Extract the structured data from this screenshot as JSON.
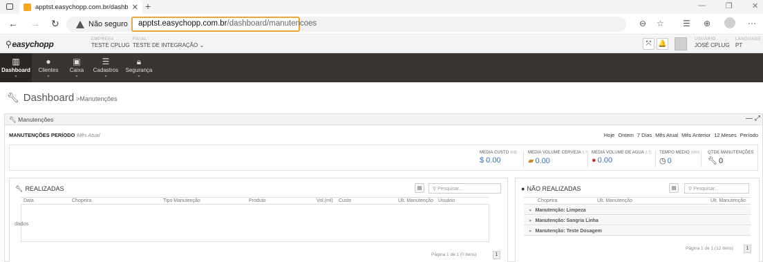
{
  "browser": {
    "tab_title": "apptst.easychopp.com.br/dashb",
    "not_secure_label": "Não seguro",
    "url_host": "apptst.easychopp.com.br",
    "url_path": "/dashboard/manutencoes"
  },
  "header": {
    "logo": "easychopp",
    "empresa_label": "EMPRESA",
    "empresa_value": "TESTE CPLUG",
    "filial_label": "FILIAL",
    "filial_value": "TESTE DE INTEGRAÇÃO ⌄",
    "usuario_label": "USUÁRIO",
    "usuario_value": "JOSÉ CPLUG",
    "language_label": "LANGUAGE",
    "language_value": "PT"
  },
  "menu": {
    "items": [
      {
        "label": "Dashboard",
        "icon": "bar-chart-icon"
      },
      {
        "label": "Clientes",
        "icon": "user-icon"
      },
      {
        "label": "Caixa",
        "icon": "cash-icon"
      },
      {
        "label": "Cadastros",
        "icon": "list-icon"
      },
      {
        "label": "Segurança",
        "icon": "lock-icon"
      }
    ]
  },
  "page": {
    "title": "Dashboard",
    "subtitle": ">Manutenções"
  },
  "panel": {
    "title": "Manutenções",
    "period_title": "MANUTENÇÕES PERÍODO",
    "period_sub": "Mês Atual",
    "period_links": [
      "Hoje",
      "Ontem",
      "7 Dias",
      "Mês Atual",
      "Mês Anterior",
      "12 Meses",
      "Período"
    ]
  },
  "stats": [
    {
      "label": "MEDIA CUSTO",
      "unit": "(R$)",
      "value": "$ 0.00"
    },
    {
      "label": "MEDIA VOLUME CERVEJA",
      "unit": "(LT)",
      "value": "0.00"
    },
    {
      "label": "MEDIA VOLUME DE AGUA",
      "unit": "(LT)",
      "value": "0.00"
    },
    {
      "label": "TEMPO MEDIO",
      "unit": "(MIN)",
      "value": "0"
    },
    {
      "label": "QTDE MANUTENÇÕES",
      "unit": "",
      "value": "0"
    }
  ],
  "realizadas": {
    "title": "REALIZADAS",
    "search_placeholder": "Pesquisar...",
    "columns": [
      "Data",
      "Chopeira",
      "Tipo Manutenção",
      "Produto",
      "Vol.(ml)",
      "Custo",
      "Ult. Manutenção",
      "Usuário"
    ],
    "empty_text": "dados",
    "pager": "Página 1 de 1 (0 itens)",
    "page_num": "1"
  },
  "nao_realizadas": {
    "title": "NÃO REALIZADAS",
    "search_placeholder": "Pesquisar...",
    "columns": [
      "Chopeira",
      "Ult. Manutenção",
      "Ult. Manutenção"
    ],
    "groups": [
      "Manutenção: Limpeza",
      "Manutenção: Sangria Linha",
      "Manutenção: Teste Dosagem"
    ],
    "pager": "Página 1 de 1 (12 itens)",
    "page_num": "1"
  }
}
